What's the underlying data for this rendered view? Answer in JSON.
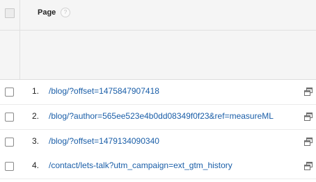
{
  "header": {
    "column_title": "Page",
    "help_glyph": "?"
  },
  "rows": [
    {
      "index": "1.",
      "page": "/blog/?offset=1475847907418"
    },
    {
      "index": "2.",
      "page": "/blog/?author=565ee523e4b0dd08349f0f23&ref=measureML"
    },
    {
      "index": "3.",
      "page": "/blog/?offset=1479134090340"
    },
    {
      "index": "4.",
      "page": "/contact/lets-talk?utm_campaign=ext_gtm_history"
    }
  ],
  "icons": {
    "row_action": "open-in-new-window-icon",
    "help": "help-icon"
  },
  "colors": {
    "link": "#1a5ea8",
    "header_bg": "#f5f5f5"
  }
}
